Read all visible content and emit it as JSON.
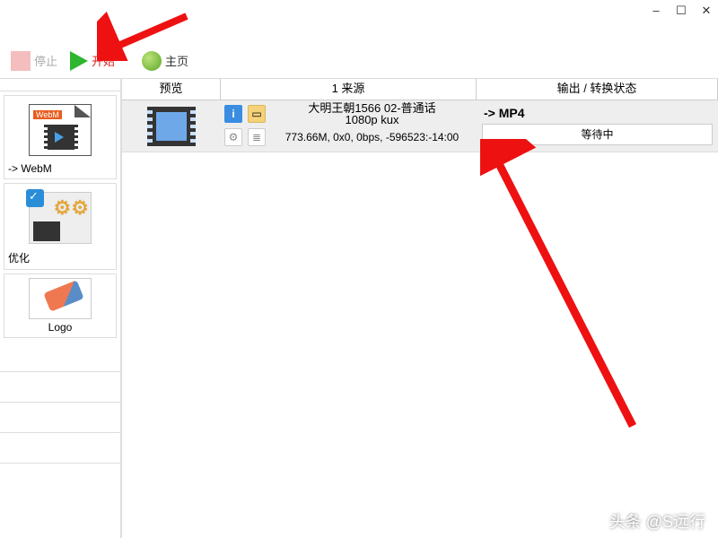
{
  "window": {
    "min": "–",
    "max": "☐",
    "close": "✕"
  },
  "toolbar": {
    "stop_label": "停止",
    "start_label": "开始",
    "home_label": "主页"
  },
  "sidebar": {
    "options": [
      {
        "name": "webm",
        "label": "-> WebM"
      },
      {
        "name": "optimize",
        "label": "优化"
      },
      {
        "name": "logo",
        "label": "Logo"
      }
    ]
  },
  "columns": {
    "preview": "预览",
    "source": "1 来源",
    "output": "输出 / 转换状态"
  },
  "row": {
    "title_line1": "大明王朝1566 02-普通话",
    "title_line2": "1080p kux",
    "meta": "773.66M, 0x0, 0bps, -596523:-14:00",
    "output_format": "-> MP4",
    "status": "等待中"
  },
  "watermark": "头条 @S远行",
  "icons": {
    "info": "i",
    "folder": "▭",
    "gear": "⚙",
    "doc": "≣"
  }
}
